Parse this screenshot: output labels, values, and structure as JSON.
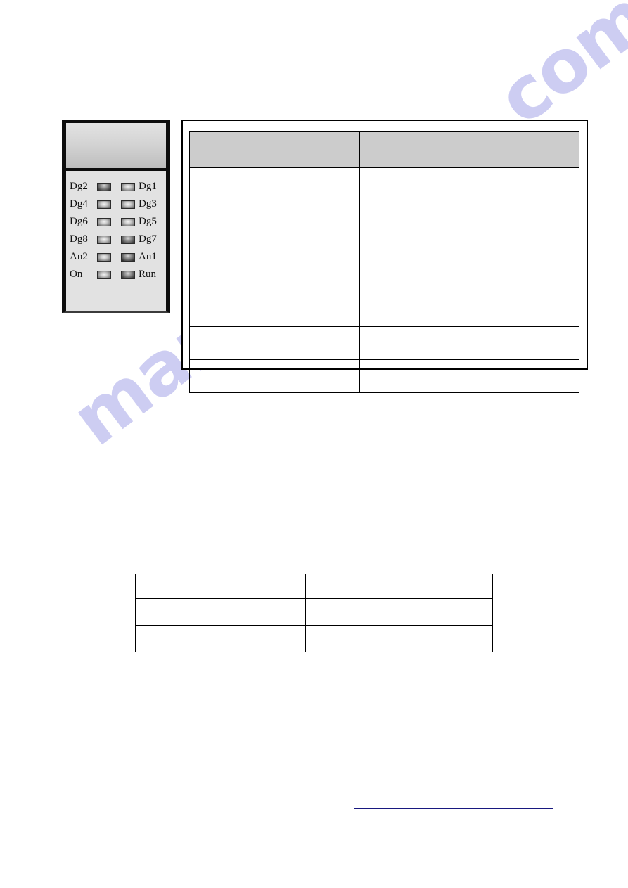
{
  "document": {
    "page_background": "#ffffff",
    "watermark": {
      "text": "manualshive.com",
      "color": "#cdcdf2"
    }
  },
  "device_panel": {
    "name": "led-indicator-panel",
    "header_gradient_top": "#e3e3e3",
    "header_gradient_bottom": "#bdbdbd",
    "body_color": "#e2e2e2",
    "border_color": "#0d0d0d",
    "rows": [
      {
        "left_label": "Dg2",
        "right_label": "Dg1",
        "left_state": "on",
        "right_state": "off"
      },
      {
        "left_label": "Dg4",
        "right_label": "Dg3",
        "left_state": "on",
        "right_state": "on"
      },
      {
        "left_label": "Dg6",
        "right_label": "Dg5",
        "left_state": "on",
        "right_state": "on"
      },
      {
        "left_label": "Dg8",
        "right_label": "Dg7",
        "left_state": "on",
        "right_state": "off"
      },
      {
        "left_label": "An2",
        "right_label": "An1",
        "left_state": "on",
        "right_state": "on"
      },
      {
        "left_label": "On",
        "right_label": "Run",
        "left_state": "on",
        "right_state": "on"
      }
    ]
  },
  "spec_table": {
    "columns": [
      "",
      "",
      ""
    ],
    "header": [
      "",
      "",
      ""
    ],
    "rows": [
      [
        "",
        "",
        ""
      ],
      [
        "",
        "",
        ""
      ],
      [
        "",
        "",
        ""
      ],
      [
        "",
        "",
        ""
      ],
      [
        "",
        "",
        ""
      ]
    ],
    "header_fill": "#cccccc",
    "border_color": "#000000"
  },
  "info_table": {
    "rows": [
      [
        "",
        ""
      ],
      [
        "",
        ""
      ],
      [
        "",
        ""
      ]
    ],
    "border_color": "#000000"
  },
  "footer": {
    "link_text": "",
    "link_color": "#1b1b8f"
  }
}
